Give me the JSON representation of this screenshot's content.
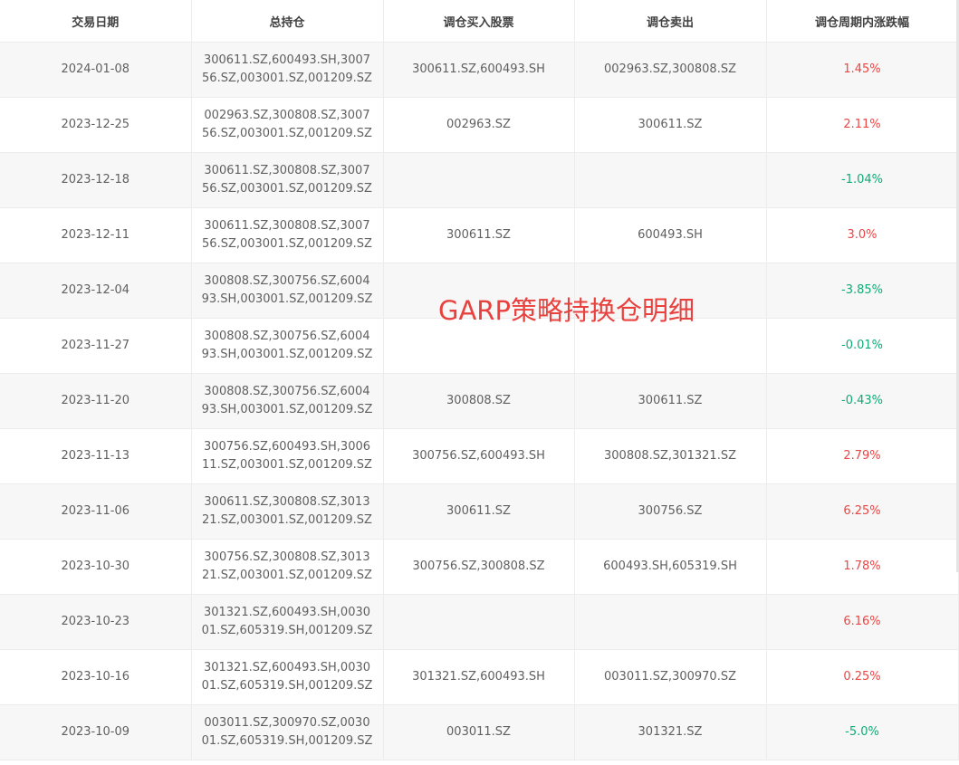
{
  "columns": {
    "date": "交易日期",
    "holdings": "总持仓",
    "buy": "调仓买入股票",
    "sell": "调仓卖出",
    "change": "调仓周期内涨跌幅"
  },
  "rows": [
    {
      "date": "2024-01-08",
      "holdings": "300611.SZ,600493.SH,300756.SZ,003001.SZ,001209.SZ",
      "buy": "300611.SZ,600493.SH",
      "sell": "002963.SZ,300808.SZ",
      "change": "1.45%"
    },
    {
      "date": "2023-12-25",
      "holdings": "002963.SZ,300808.SZ,300756.SZ,003001.SZ,001209.SZ",
      "buy": "002963.SZ",
      "sell": "300611.SZ",
      "change": "2.11%"
    },
    {
      "date": "2023-12-18",
      "holdings": "300611.SZ,300808.SZ,300756.SZ,003001.SZ,001209.SZ",
      "buy": "",
      "sell": "",
      "change": "-1.04%"
    },
    {
      "date": "2023-12-11",
      "holdings": "300611.SZ,300808.SZ,300756.SZ,003001.SZ,001209.SZ",
      "buy": "300611.SZ",
      "sell": "600493.SH",
      "change": "3.0%"
    },
    {
      "date": "2023-12-04",
      "holdings": "300808.SZ,300756.SZ,600493.SH,003001.SZ,001209.SZ",
      "buy": "",
      "sell": "",
      "change": "-3.85%"
    },
    {
      "date": "2023-11-27",
      "holdings": "300808.SZ,300756.SZ,600493.SH,003001.SZ,001209.SZ",
      "buy": "",
      "sell": "",
      "change": "-0.01%"
    },
    {
      "date": "2023-11-20",
      "holdings": "300808.SZ,300756.SZ,600493.SH,003001.SZ,001209.SZ",
      "buy": "300808.SZ",
      "sell": "300611.SZ",
      "change": "-0.43%"
    },
    {
      "date": "2023-11-13",
      "holdings": "300756.SZ,600493.SH,300611.SZ,003001.SZ,001209.SZ",
      "buy": "300756.SZ,600493.SH",
      "sell": "300808.SZ,301321.SZ",
      "change": "2.79%"
    },
    {
      "date": "2023-11-06",
      "holdings": "300611.SZ,300808.SZ,301321.SZ,003001.SZ,001209.SZ",
      "buy": "300611.SZ",
      "sell": "300756.SZ",
      "change": "6.25%"
    },
    {
      "date": "2023-10-30",
      "holdings": "300756.SZ,300808.SZ,301321.SZ,003001.SZ,001209.SZ",
      "buy": "300756.SZ,300808.SZ",
      "sell": "600493.SH,605319.SH",
      "change": "1.78%"
    },
    {
      "date": "2023-10-23",
      "holdings": "301321.SZ,600493.SH,003001.SZ,605319.SH,001209.SZ",
      "buy": "",
      "sell": "",
      "change": "6.16%"
    },
    {
      "date": "2023-10-16",
      "holdings": "301321.SZ,600493.SH,003001.SZ,605319.SH,001209.SZ",
      "buy": "301321.SZ,600493.SH",
      "sell": "003011.SZ,300970.SZ",
      "change": "0.25%"
    },
    {
      "date": "2023-10-09",
      "holdings": "003011.SZ,300970.SZ,003001.SZ,605319.SH,001209.SZ",
      "buy": "003011.SZ",
      "sell": "301321.SZ",
      "change": "-5.0%"
    }
  ],
  "overlay_title": "GARP策略持换仓明细",
  "colors": {
    "positive": "#ee4444",
    "negative": "#11aa77",
    "overlay": "#e8413e"
  }
}
